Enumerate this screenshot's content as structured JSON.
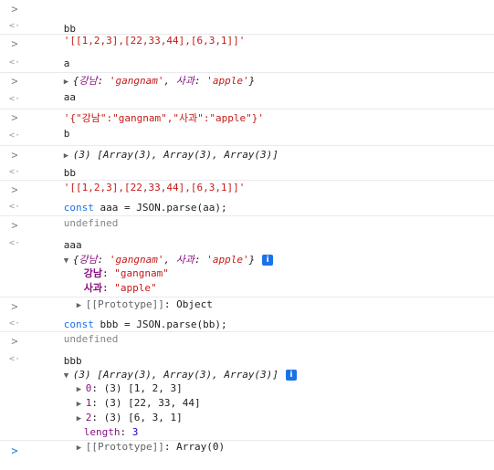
{
  "icons": {
    "prompt": ">",
    "return": "<·",
    "expand_collapsed": "▶",
    "expand_open": "▼",
    "info": "i"
  },
  "e1": {
    "input": "bb",
    "output": "'[[1,2,3],[22,33,44],[6,3,1]]'"
  },
  "e2": {
    "input": "a",
    "k1": "강남",
    "v1": "'gangnam'",
    "k2": "사과",
    "v2": "'apple'"
  },
  "e3": {
    "input": "aa",
    "output": "'{\"강남\":\"gangnam\",\"사과\":\"apple\"}'"
  },
  "e4": {
    "input": "b",
    "count": "(3)",
    "preview": "[Array(3), Array(3), Array(3)]"
  },
  "e5": {
    "input": "bb",
    "output": "'[[1,2,3],[22,33,44],[6,3,1]]'"
  },
  "e6": {
    "kw": "const",
    "rest": " aaa = JSON.parse(aa);",
    "result": "undefined"
  },
  "e7": {
    "input": "aaa",
    "k1": "강남",
    "v1": "'gangnam'",
    "k2": "사과",
    "v2": "'apple'",
    "p1k": "강남",
    "p1v": "\"gangnam\"",
    "p2k": "사과",
    "p2v": "\"apple\"",
    "proto": "[[Prototype]]",
    "proto_val": "Object"
  },
  "e8": {
    "kw": "const",
    "rest": " bbb = JSON.parse(bb);",
    "result": "undefined"
  },
  "e9": {
    "input": "bbb",
    "count": "(3)",
    "preview": "[Array(3), Array(3), Array(3)]",
    "items": [
      {
        "idx": "0",
        "count": "(3)",
        "values": "[1, 2, 3]"
      },
      {
        "idx": "1",
        "count": "(3)",
        "values": "[22, 33, 44]"
      },
      {
        "idx": "2",
        "count": "(3)",
        "values": "[6, 3, 1]"
      }
    ],
    "length_key": "length",
    "length_val": "3",
    "proto": "[[Prototype]]",
    "proto_val": "Array(0)"
  }
}
